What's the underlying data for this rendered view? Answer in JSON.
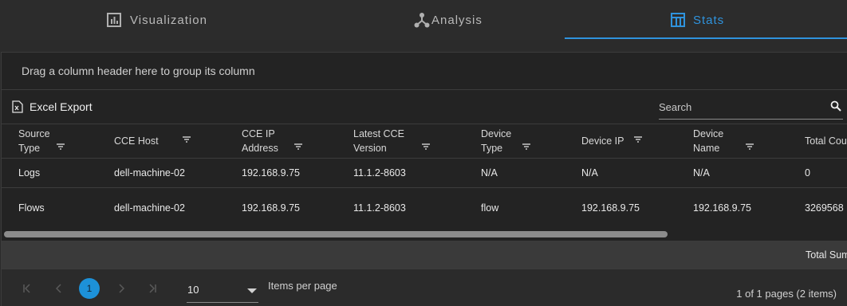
{
  "tabs": [
    {
      "label": "Visualization",
      "icon": "bar-chart-icon",
      "active": false
    },
    {
      "label": "Analysis",
      "icon": "network-icon",
      "active": false
    },
    {
      "label": "Stats",
      "icon": "table-icon",
      "active": true
    }
  ],
  "colors": {
    "accent": "#2f93dd",
    "background": "#2b2b2b",
    "grid_bg": "#232323"
  },
  "group_bar": {
    "text": "Drag a column header here to group its column"
  },
  "toolbar": {
    "export_label": "Excel Export",
    "search_placeholder": "Search"
  },
  "table": {
    "columns": [
      {
        "line1": "Source",
        "line2": "Type"
      },
      {
        "line1": "CCE Host",
        "line2": ""
      },
      {
        "line1": "CCE IP",
        "line2": "Address"
      },
      {
        "line1": "Latest CCE",
        "line2": "Version"
      },
      {
        "line1": "Device",
        "line2": "Type"
      },
      {
        "line1": "Device IP",
        "line2": ""
      },
      {
        "line1": "Device",
        "line2": "Name"
      },
      {
        "line1": "Total Count",
        "line2": ""
      }
    ],
    "rows": [
      [
        "Logs",
        "dell-machine-02",
        "192.168.9.75",
        "11.1.2-8603",
        "N/A",
        "N/A",
        "N/A",
        "0"
      ],
      [
        "Flows",
        "dell-machine-02",
        "192.168.9.75",
        "11.1.2-8603",
        "flow",
        "192.168.9.75",
        "192.168.9.75",
        "3269568"
      ]
    ]
  },
  "summary": {
    "label": "Total Sum"
  },
  "pager": {
    "current_page": "1",
    "page_size": "10",
    "items_per_page_label": "Items per page",
    "page_info": "1 of 1 pages (2 items)"
  }
}
